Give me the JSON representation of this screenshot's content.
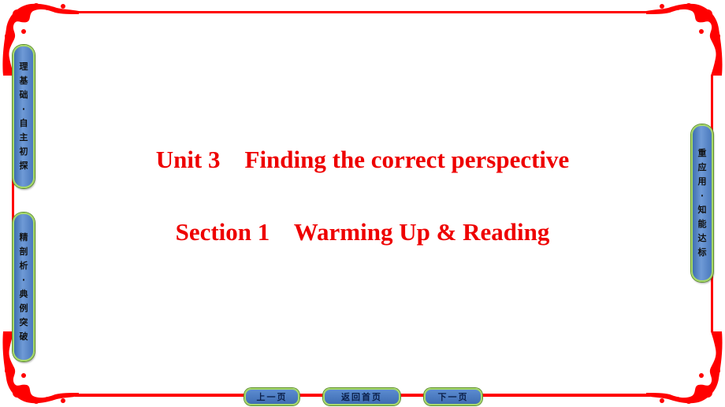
{
  "colors": {
    "frame": "#ff0000",
    "title": "#ee0000",
    "tab_fill": "#4f80c4",
    "tab_border": "#a6d86a"
  },
  "side_tabs": {
    "left_top": [
      "理",
      "基",
      "础",
      "·",
      "自",
      "主",
      "初",
      "探"
    ],
    "left_bottom": [
      "精",
      "剖",
      "析",
      "·",
      "典",
      "例",
      "突",
      "破"
    ],
    "right": [
      "重",
      "应",
      "用",
      "·",
      "知",
      "能",
      "达",
      "标"
    ]
  },
  "title": {
    "unit": "Unit 3    Finding the correct perspective",
    "section": "Section 1    Warming Up & Reading"
  },
  "nav": {
    "prev": "上一页",
    "home": "返回首页",
    "next": "下一页"
  }
}
